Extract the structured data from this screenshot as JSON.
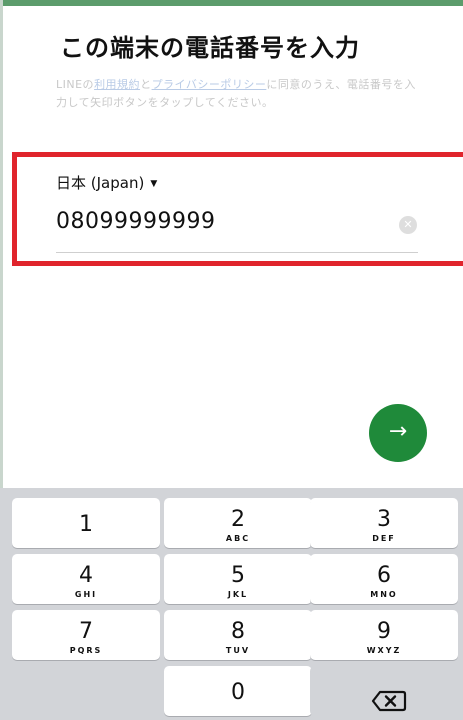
{
  "screen": {
    "title": "この端末の電話番号を入力",
    "description": {
      "part1": "LINEの",
      "terms_link": "利用規約",
      "part2": "と",
      "privacy_link": "プライバシーポリシー",
      "part3": "に同意のうえ、電話番号を入力して矢印ボタンをタップしてください。"
    }
  },
  "form": {
    "country": "日本 (Japan)",
    "country_caret": "▼",
    "phone_value": "08099999999",
    "clear_icon": "clear-icon"
  },
  "next_button": {
    "icon": "→",
    "color": "#1f8a3a"
  },
  "keypad": {
    "keys": [
      {
        "num": "1",
        "letters": ""
      },
      {
        "num": "2",
        "letters": "ABC"
      },
      {
        "num": "3",
        "letters": "DEF"
      },
      {
        "num": "4",
        "letters": "GHI"
      },
      {
        "num": "5",
        "letters": "JKL"
      },
      {
        "num": "6",
        "letters": "MNO"
      },
      {
        "num": "7",
        "letters": "PQRS"
      },
      {
        "num": "8",
        "letters": "TUV"
      },
      {
        "num": "9",
        "letters": "WXYZ"
      },
      {
        "num": "0",
        "letters": ""
      }
    ],
    "bottom_left": "",
    "backspace_icon": "backspace-icon"
  },
  "colors": {
    "accent_green": "#1f8a3a",
    "highlight_red": "#e0242c",
    "keypad_bg": "#d2d4d8"
  }
}
